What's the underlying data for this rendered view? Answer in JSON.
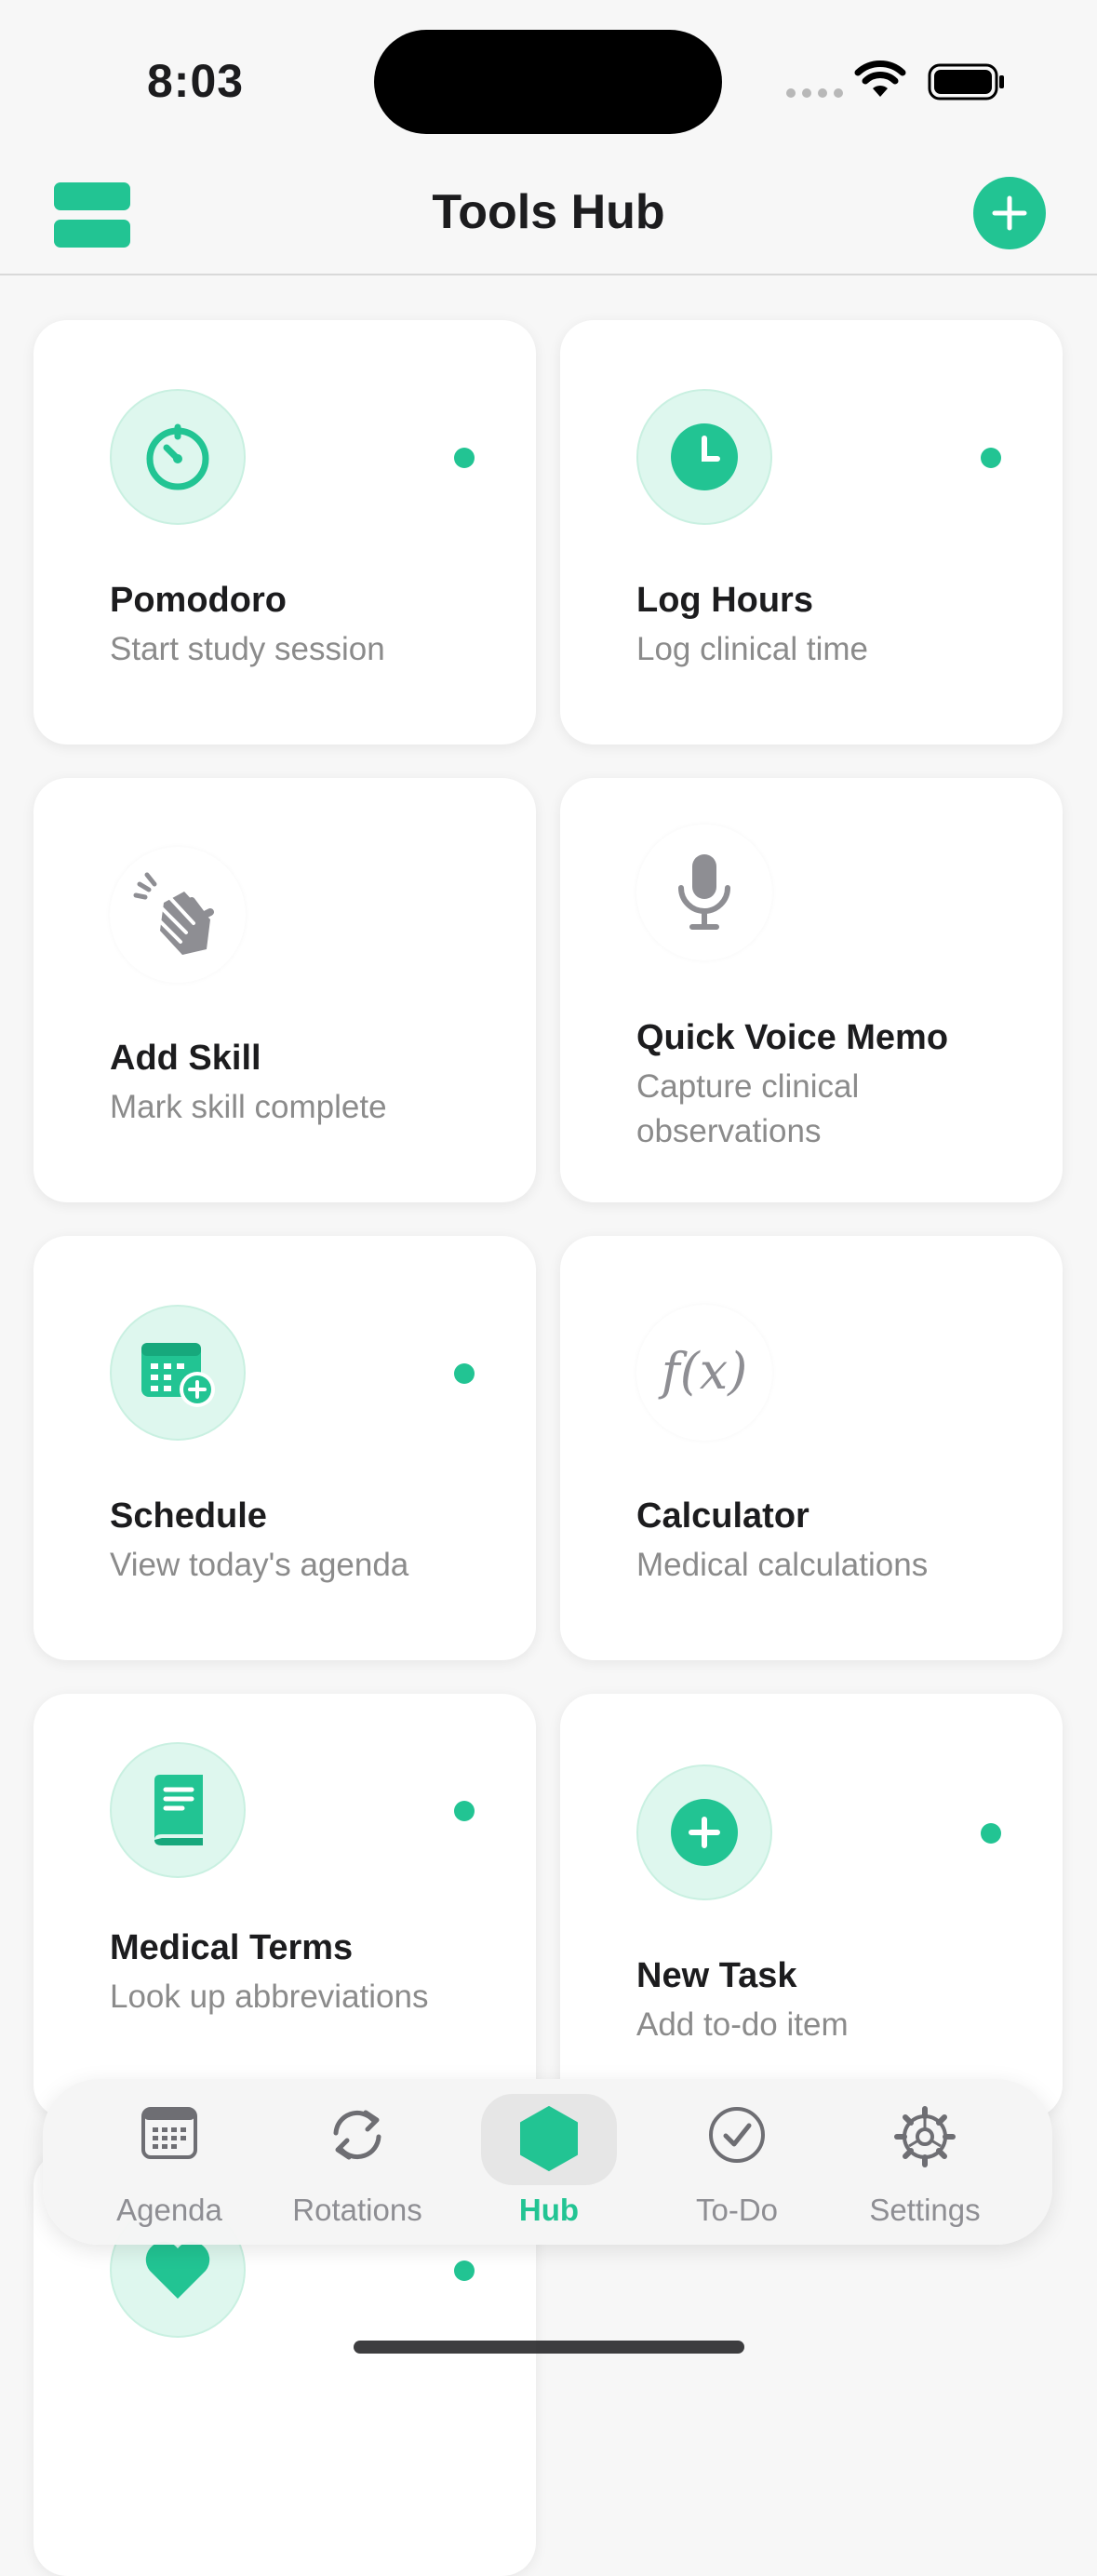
{
  "status_bar": {
    "time": "8:03"
  },
  "header": {
    "title": "Tools Hub",
    "menu_icon": "menu-icon",
    "add_icon": "plus-icon"
  },
  "accent_color": "#22c493",
  "tools": [
    {
      "title": "Pomodoro",
      "subtitle": "Start study session",
      "icon": "timer-icon",
      "active": true
    },
    {
      "title": "Log Hours",
      "subtitle": "Log clinical time",
      "icon": "clock-icon",
      "active": true
    },
    {
      "title": "Add Skill",
      "subtitle": "Mark skill complete",
      "icon": "clapping-hands-icon",
      "active": false
    },
    {
      "title": "Quick Voice Memo",
      "subtitle": "Capture clinical observations",
      "icon": "microphone-icon",
      "active": false
    },
    {
      "title": "Schedule",
      "subtitle": "View today's agenda",
      "icon": "calendar-add-icon",
      "active": true
    },
    {
      "title": "Calculator",
      "subtitle": "Medical calculations",
      "icon": "function-icon",
      "active": false
    },
    {
      "title": "Medical Terms",
      "subtitle": "Look up abbreviations",
      "icon": "book-icon",
      "active": true
    },
    {
      "title": "New Task",
      "subtitle": "Add to-do item",
      "icon": "plus-circle-icon",
      "active": true
    },
    {
      "title": "",
      "subtitle": "",
      "icon": "heart-icon",
      "active": true
    }
  ],
  "tab_bar": {
    "tabs": [
      {
        "label": "Agenda",
        "icon": "calendar-icon"
      },
      {
        "label": "Rotations",
        "icon": "rotate-icon"
      },
      {
        "label": "Hub",
        "icon": "hexagon-icon"
      },
      {
        "label": "To-Do",
        "icon": "check-circle-icon"
      },
      {
        "label": "Settings",
        "icon": "gear-icon"
      }
    ],
    "selected": "Hub"
  }
}
